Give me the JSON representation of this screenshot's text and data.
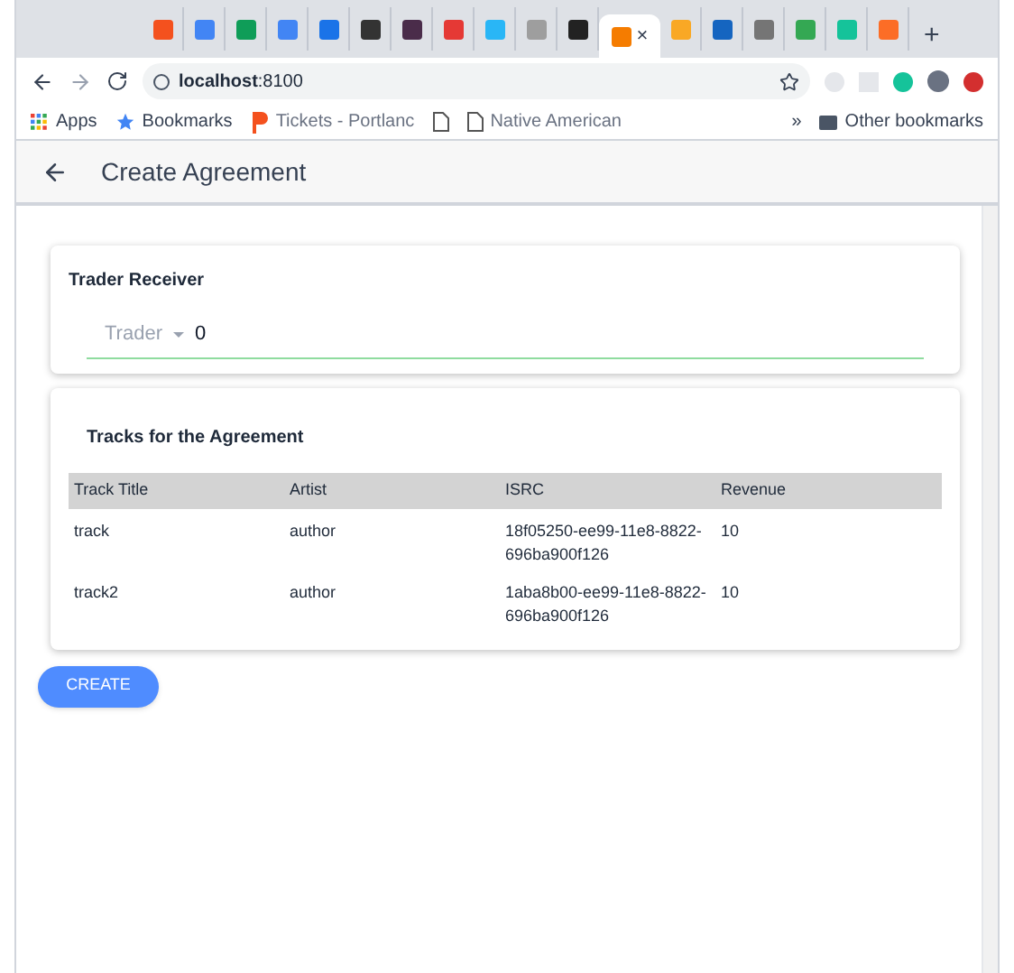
{
  "browser": {
    "tabs": [
      {
        "color": "#f4511e",
        "selected": false
      },
      {
        "color": "#4285f4",
        "selected": false
      },
      {
        "color": "#0f9d58",
        "selected": false
      },
      {
        "color": "#4285f4",
        "selected": false
      },
      {
        "color": "#1a73e8",
        "selected": false
      },
      {
        "color": "#333333",
        "selected": false
      },
      {
        "color": "#4a2c4a",
        "selected": false
      },
      {
        "color": "#e53935",
        "selected": false
      },
      {
        "color": "#29b6f6",
        "selected": false
      },
      {
        "color": "#9e9e9e",
        "selected": false
      },
      {
        "color": "#222222",
        "selected": false
      },
      {
        "color": "#f57c00",
        "selected": true,
        "close": "×"
      },
      {
        "color": "#f9a825",
        "selected": false
      },
      {
        "color": "#1565c0",
        "selected": false
      },
      {
        "color": "#757575",
        "selected": false
      },
      {
        "color": "#34a853",
        "selected": false
      },
      {
        "color": "#15c39a",
        "selected": false
      },
      {
        "color": "#fc6d26",
        "selected": false
      }
    ],
    "new_tab": "+",
    "address": {
      "host": "localhost",
      "port": ":8100"
    },
    "bookmarks": [
      {
        "kind": "apps",
        "label": "Apps"
      },
      {
        "kind": "star",
        "label": "Bookmarks"
      },
      {
        "kind": "brand",
        "label": "Tickets - Portlanc"
      },
      {
        "kind": "page"
      },
      {
        "kind": "page",
        "label": "Native American"
      }
    ],
    "more": "»",
    "other_bookmarks": "Other bookmarks"
  },
  "header": {
    "title": "Create Agreement"
  },
  "trader_card": {
    "title": "Trader Receiver",
    "field": {
      "label": "Trader",
      "value": "0"
    }
  },
  "tracks_card": {
    "title": "Tracks for the Agreement",
    "columns": [
      "Track Title",
      "Artist",
      "ISRC",
      "Revenue"
    ],
    "rows": [
      [
        "track",
        "author",
        "18f05250-ee99-11e8-8822-696ba900f126",
        "10"
      ],
      [
        "track2",
        "author",
        "1aba8b00-ee99-11e8-8822-696ba900f126",
        "10"
      ]
    ]
  },
  "create_button": "CREATE"
}
